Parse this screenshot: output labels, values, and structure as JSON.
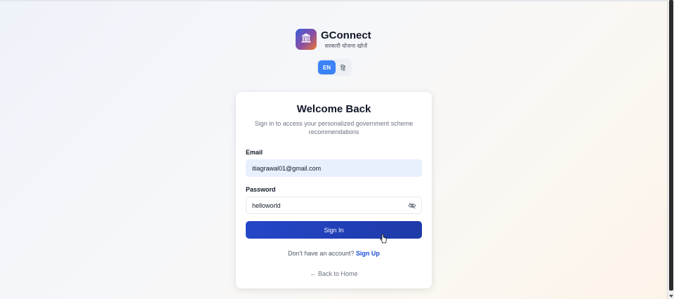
{
  "brand": {
    "title": "GConnect",
    "subtitle": "सरकारी योजना खोजें",
    "logo_icon": "bank-icon",
    "logo_colors": [
      "#3b5bdb",
      "#8b4fa3",
      "#f07a2b"
    ]
  },
  "language": {
    "options": [
      "EN",
      "हि"
    ],
    "selected": "EN",
    "accent": "#3b82f6"
  },
  "login": {
    "title": "Welcome Back",
    "subtitle": "Sign in to access your personalized government scheme recommendations",
    "email_label": "Email",
    "email_value": "itiagrawal01@gmail.com",
    "password_label": "Password",
    "password_value": "helloworld",
    "password_toggle_icon": "eye-off-icon",
    "submit_label": "Sign In",
    "submit_color": "#2446c8",
    "signup_prompt": "Don't have an account?",
    "signup_link": "Sign Up",
    "back_link": "← Back to Home"
  }
}
